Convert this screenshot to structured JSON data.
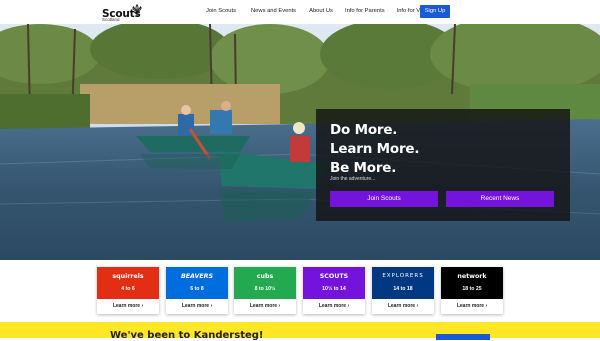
{
  "header": {
    "logo_word": "Scouts",
    "logo_sub": "Scotland",
    "nav": [
      "Join Scouts",
      "News and Events",
      "About Us",
      "Info for Parents",
      "Info for Volunteers"
    ],
    "signup_label": "Sign Up"
  },
  "hero": {
    "headline_1": "Do More.",
    "headline_2": "Learn More.",
    "headline_3": "Be More.",
    "tagline": "Join the adventure...",
    "join_label": "Join Scouts",
    "news_label": "Recent News"
  },
  "sections": [
    {
      "name": "Squirrels",
      "logo": "squirrels",
      "age": "4 to 6",
      "color": "#e22e12",
      "more": "Learn more ›"
    },
    {
      "name": "Beavers",
      "logo": "BEAVERS",
      "age": "6 to 8",
      "color": "#006ddf",
      "more": "Learn more ›"
    },
    {
      "name": "Cubs",
      "logo": "cubs",
      "age": "8 to 10½",
      "color": "#23a950",
      "more": "Learn more ›"
    },
    {
      "name": "Scouts",
      "logo": "SCOUTS",
      "age": "10½ to 14",
      "color": "#7413dc",
      "more": "Learn more ›"
    },
    {
      "name": "Explorers",
      "logo": "EXPLORERS",
      "age": "14 to 18",
      "color": "#003982",
      "more": "Learn more ›"
    },
    {
      "name": "Network",
      "logo": "network",
      "age": "18 to 25",
      "color": "#000000",
      "more": "Learn more ›"
    }
  ],
  "banner": {
    "title": "We've been to Kandersteg!"
  }
}
